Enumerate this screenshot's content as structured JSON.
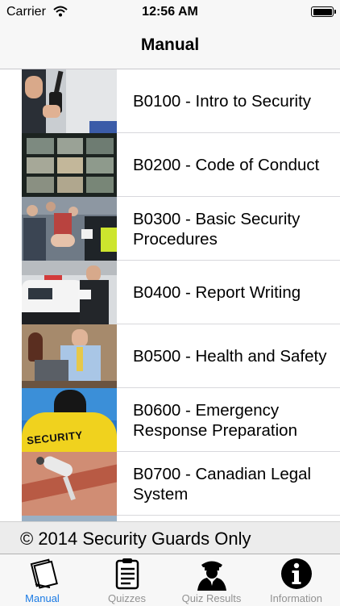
{
  "status_bar": {
    "carrier": "Carrier",
    "time": "12:56 AM"
  },
  "nav": {
    "title": "Manual"
  },
  "manual_items": [
    {
      "label": "B0100 - Intro to Security"
    },
    {
      "label": "B0200 - Code of Conduct"
    },
    {
      "label": "B0300 - Basic Security Procedures"
    },
    {
      "label": "B0400 - Report Writing"
    },
    {
      "label": "B0500 - Health and Safety"
    },
    {
      "label": "B0600 - Emergency Response Preparation"
    },
    {
      "label": "B0700 - Canadian Legal System"
    }
  ],
  "thumb_text": {
    "security": "SECURITY"
  },
  "footer": {
    "text": "© 2014 Security Guards Only"
  },
  "tabs": [
    {
      "label": "Manual",
      "icon": "manual-icon",
      "active": true
    },
    {
      "label": "Quizzes",
      "icon": "quiz-icon",
      "active": false
    },
    {
      "label": "Quiz Results",
      "icon": "guard-icon",
      "active": false
    },
    {
      "label": "Information",
      "icon": "info-icon",
      "active": false
    }
  ],
  "colors": {
    "accent": "#1a7ae4",
    "inactive": "#929292"
  }
}
